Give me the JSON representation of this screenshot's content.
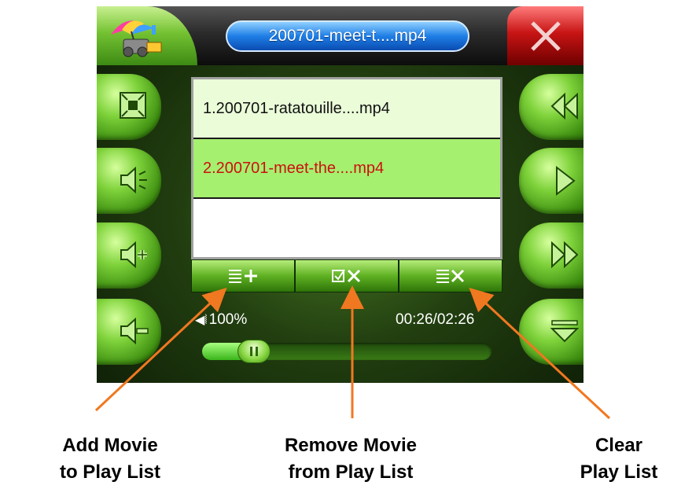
{
  "window": {
    "title": "200701-meet-t....mp4"
  },
  "playlist": {
    "items": [
      {
        "label": "1.200701-ratatouille....mp4",
        "selected": false
      },
      {
        "label": "2.200701-meet-the....mp4",
        "selected": true
      },
      {
        "label": "",
        "selected": false
      }
    ]
  },
  "toolbar": {
    "add_label": "≣+",
    "remove_label": "☑X",
    "clear_label": "≣X"
  },
  "status": {
    "volume": "100%",
    "time": "00:26/02:26"
  },
  "progress": {
    "fraction": 0.18
  },
  "callouts": {
    "add": {
      "line1": "Add Movie",
      "line2": "to Play List"
    },
    "remove": {
      "line1": "Remove Movie",
      "line2": "from Play List"
    },
    "clear": {
      "line1": "Clear",
      "line2": "Play List"
    }
  },
  "colors": {
    "accent_green": "#6fc22c",
    "callout_orange": "#f07820",
    "selected_text": "#cc1010",
    "title_blue": "#1e7ee6",
    "close_red": "#c81414"
  },
  "icons": {
    "app": "movie-camera-umbrella-icon",
    "fullscreen": "fullscreen-icon",
    "mute": "mute-icon",
    "volume_up": "volume-up-icon",
    "volume_down": "volume-down-icon",
    "previous": "previous-icon",
    "play": "play-icon",
    "next": "next-icon",
    "menu": "menu-down-icon",
    "close": "close-icon"
  }
}
